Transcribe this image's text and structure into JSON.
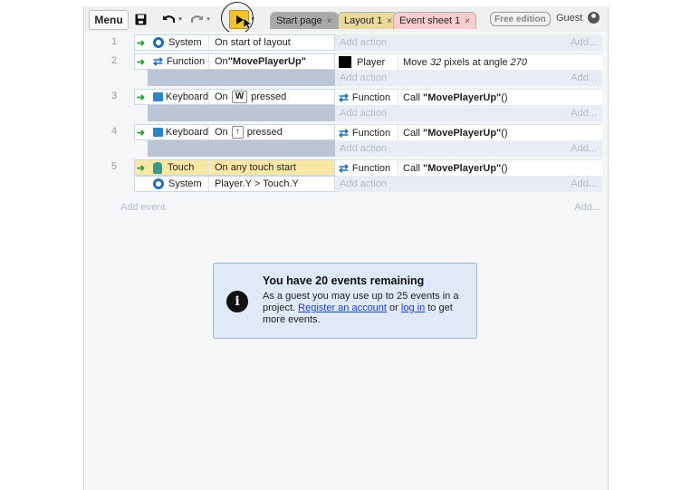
{
  "toolbar": {
    "menu_label": "Menu",
    "tabs": [
      {
        "label": "Start page",
        "bg": "#a9a9a9"
      },
      {
        "label": "Layout 1",
        "bg": "#e8d99a"
      },
      {
        "label": "Event sheet 1",
        "bg": "#f7cdd0"
      }
    ],
    "tab_close": "×",
    "free_edition": "Free edition",
    "guest": "Guest"
  },
  "events": {
    "add_action": "Add action",
    "add": "Add...",
    "add_event": "Add event",
    "rows": [
      {
        "num": "1",
        "cond_obj": "System",
        "cond_text": "On start of layout"
      },
      {
        "num": "2",
        "cond_obj": "Function",
        "cond_text_pre": "On ",
        "cond_text_bold": "\"MovePlayerUp\"",
        "act_obj": "Player",
        "act_text_pre": "Move ",
        "act_val1": "32",
        "act_text_mid": " pixels at angle ",
        "act_val2": "270"
      },
      {
        "num": "3",
        "cond_obj": "Keyboard",
        "cond_text_pre": "On",
        "cond_key": "W",
        "cond_text_post": "pressed",
        "act_obj": "Function",
        "act_text_pre": "Call ",
        "act_text_bold": "\"MovePlayerUp\"",
        "act_text_post": " ()"
      },
      {
        "num": "4",
        "cond_obj": "Keyboard",
        "cond_text_pre": "On",
        "cond_key": "↑",
        "cond_text_post": "pressed",
        "act_obj": "Function",
        "act_text_pre": "Call ",
        "act_text_bold": "\"MovePlayerUp\"",
        "act_text_post": " ()"
      },
      {
        "num": "5",
        "cond_obj": "Touch",
        "cond_text": "On any touch start",
        "cond2_obj": "System",
        "cond2_text": "Player.Y > Touch.Y",
        "act_obj": "Function",
        "act_text_pre": "Call ",
        "act_text_bold": "\"MovePlayerUp\"",
        "act_text_post": " ()"
      }
    ]
  },
  "notice": {
    "title": "You have 20 events remaining",
    "body_pre": "As a guest you may use up to 25 events in a project. ",
    "link1": "Register an account",
    "body_mid": " or ",
    "link2": "log in",
    "body_post": " to get more events."
  },
  "arrow_glyph": "➜",
  "info_glyph": "i",
  "colors": {
    "play_button": "#f1c232",
    "touch_highlight": "#fbe8a6",
    "arrow_green": "#2e9d3a"
  }
}
